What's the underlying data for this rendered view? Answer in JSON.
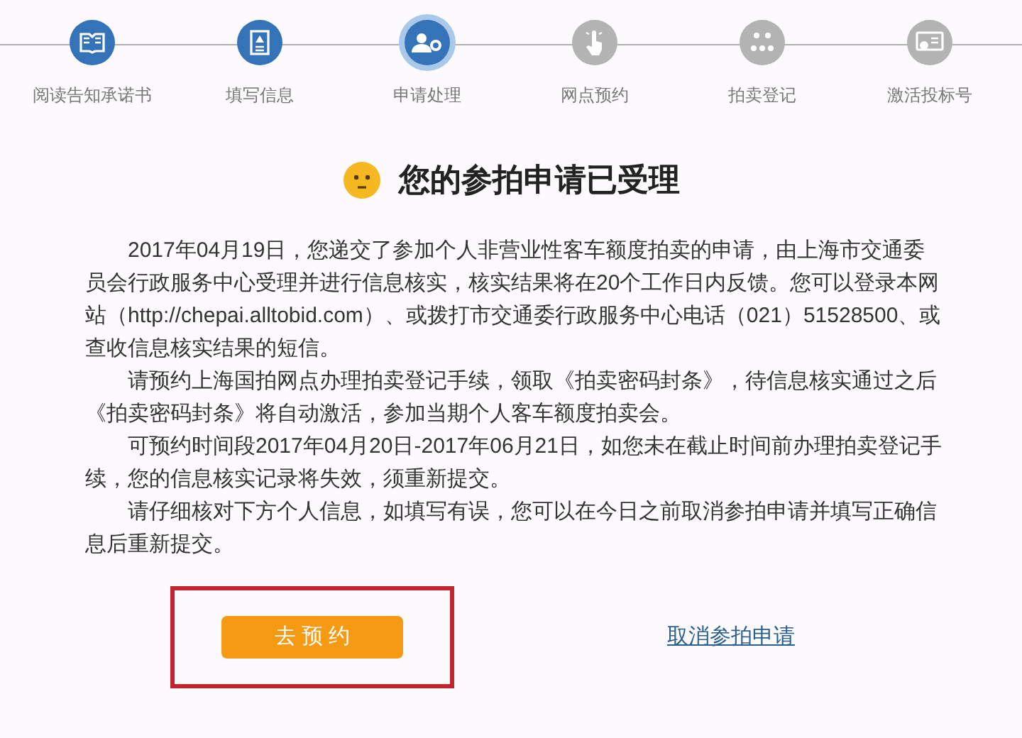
{
  "steps": [
    {
      "label": "阅读告知承诺书",
      "done": true,
      "selected": false
    },
    {
      "label": "填写信息",
      "done": true,
      "selected": false
    },
    {
      "label": "申请处理",
      "done": true,
      "selected": true
    },
    {
      "label": "网点预约",
      "done": false,
      "selected": false
    },
    {
      "label": "拍卖登记",
      "done": false,
      "selected": false
    },
    {
      "label": "激活投标号",
      "done": false,
      "selected": false
    }
  ],
  "title": "您的参拍申请已受理",
  "paragraphs": [
    "2017年04月19日，您递交了参加个人非营业性客车额度拍卖的申请，由上海市交通委员会行政服务中心受理并进行信息核实，核实结果将在20个工作日内反馈。您可以登录本网站（http://chepai.alltobid.com）、或拨打市交通委行政服务中心电话（021）51528500、或查收信息核实结果的短信。",
    "请预约上海国拍网点办理拍卖登记手续，领取《拍卖密码封条》，待信息核实通过之后《拍卖密码封条》将自动激活，参加当期个人客车额度拍卖会。",
    "可预约时间段2017年04月20日-2017年06月21日，如您未在截止时间前办理拍卖登记手续，您的信息核实记录将失效，须重新提交。",
    "请仔细核对下方个人信息，如填写有误，您可以在今日之前取消参拍申请并填写正确信息后重新提交。"
  ],
  "primary_button": {
    "label": "去 预 约",
    "highlighted": true
  },
  "cancel_link": "取消参拍申请"
}
